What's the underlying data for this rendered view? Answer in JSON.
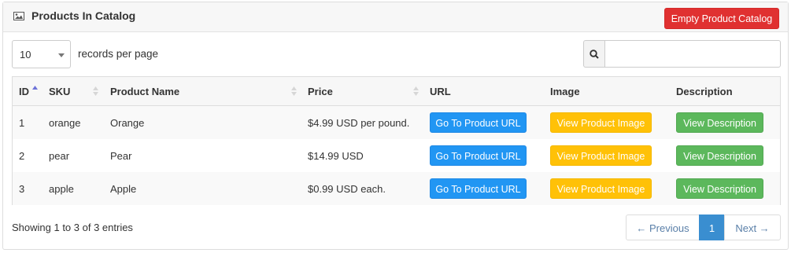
{
  "panel": {
    "title": "Products In Catalog",
    "icon": "image-icon",
    "empty_button": "Empty Product Catalog"
  },
  "controls": {
    "length_value": "10",
    "length_label": "records per page",
    "search_value": "",
    "search_icon": "search-icon"
  },
  "table": {
    "headers": [
      "ID",
      "SKU",
      "Product Name",
      "Price",
      "URL",
      "Image",
      "Description"
    ],
    "rows": [
      {
        "id": "1",
        "sku": "orange",
        "name": "Orange",
        "price": "$4.99 USD per pound.",
        "url_btn": "Go To Product URL",
        "image_btn": "View Product Image",
        "desc_btn": "View Description"
      },
      {
        "id": "2",
        "sku": "pear",
        "name": "Pear",
        "price": "$14.99 USD",
        "url_btn": "Go To Product URL",
        "image_btn": "View Product Image",
        "desc_btn": "View Description"
      },
      {
        "id": "3",
        "sku": "apple",
        "name": "Apple",
        "price": "$0.99 USD each.",
        "url_btn": "Go To Product URL",
        "image_btn": "View Product Image",
        "desc_btn": "View Description"
      }
    ]
  },
  "footer": {
    "info": "Showing 1 to 3 of 3 entries",
    "prev": "← Previous",
    "page": "1",
    "next": "Next →"
  },
  "colors": {
    "danger": "#e03131",
    "primary": "#2196f3",
    "warning": "#ffc107",
    "success": "#5cb85c",
    "active_page": "#3a8ed0"
  }
}
